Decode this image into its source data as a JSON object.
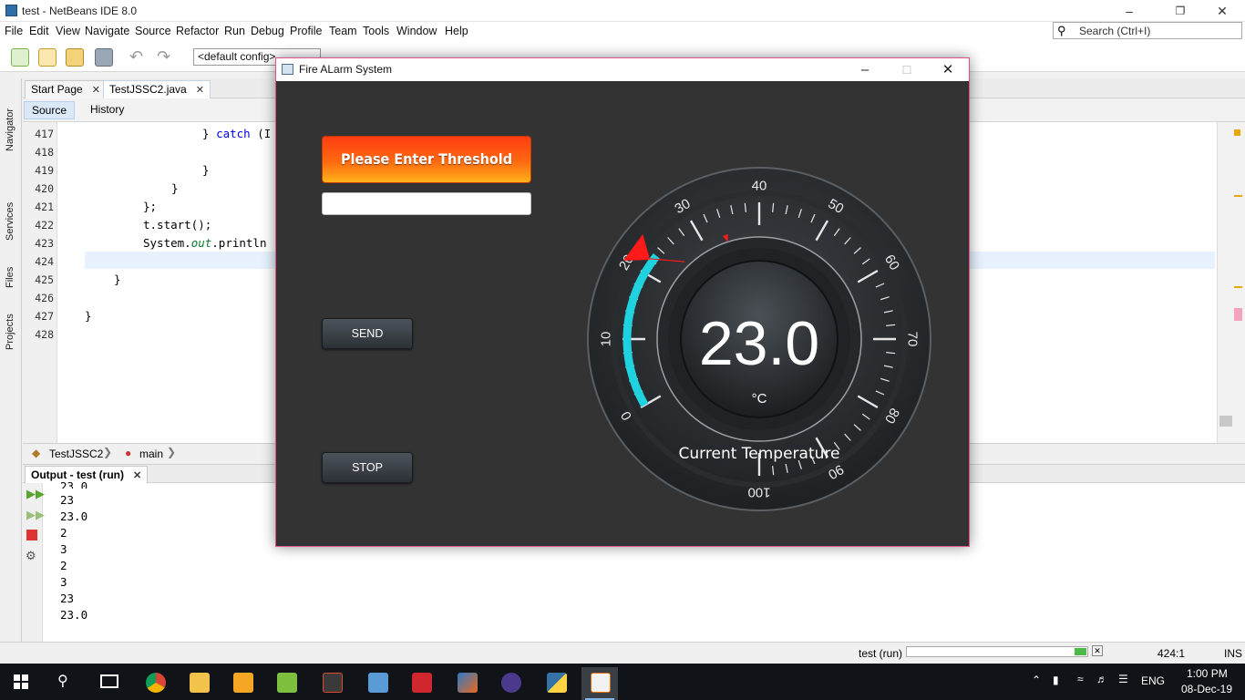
{
  "window": {
    "title": "test - NetBeans IDE 8.0"
  },
  "menu": [
    "File",
    "Edit",
    "View",
    "Navigate",
    "Source",
    "Refactor",
    "Run",
    "Debug",
    "Profile",
    "Team",
    "Tools",
    "Window",
    "Help"
  ],
  "search": {
    "placeholder": "Search (Ctrl+I)"
  },
  "toolbar": {
    "config": "<default config>"
  },
  "left_panels": [
    "Navigator",
    "Services",
    "Files",
    "Projects"
  ],
  "editor_tabs": [
    {
      "label": "Start Page"
    },
    {
      "label": "TestJSSC2.java"
    }
  ],
  "editor_subtabs": [
    "Source",
    "History"
  ],
  "editor": {
    "line_numbers": [
      "417",
      "418",
      "419",
      "420",
      "421",
      "422",
      "423",
      "424",
      "425",
      "426",
      "427",
      "428"
    ],
    "lines": {
      "l417a": "} ",
      "l417b": "catch",
      "l417c": " (I",
      "l419": "}",
      "l420": "}",
      "l421": "};",
      "l422": "t.start();",
      "l423a": "System.",
      "l423b": "out",
      "l423c": ".println",
      "l425": "}",
      "l427": "}"
    }
  },
  "breadcrumb": [
    "TestJSSC2",
    "main"
  ],
  "output": {
    "tab": "Output - test (run)",
    "lines": [
      "23.0",
      "23",
      "23.0",
      "2",
      "3",
      "2",
      "3",
      "23",
      "23.0"
    ]
  },
  "status": {
    "task": "test (run)",
    "progress": 0.92,
    "position": "424:1",
    "mode": "INS"
  },
  "taskbar": {
    "time": "1:00 PM",
    "date": "08-Dec-19",
    "lang": "ENG"
  },
  "dialog": {
    "title": "Fire ALarm System",
    "threshold_label": "Please Enter Threshold",
    "threshold_value": "",
    "send_label": "SEND",
    "stop_label": "STOP"
  },
  "gauge": {
    "value": "23.0",
    "unit": "°C",
    "caption": "Current Temperature",
    "min": 0,
    "max": 100,
    "reading": 23.0,
    "threshold_marker": 22,
    "ticks": [
      "0",
      "10",
      "20",
      "30",
      "40",
      "50",
      "60",
      "70",
      "80",
      "90",
      "100"
    ],
    "accent": "#1fd2df",
    "marker_color": "#ff1a1a"
  }
}
